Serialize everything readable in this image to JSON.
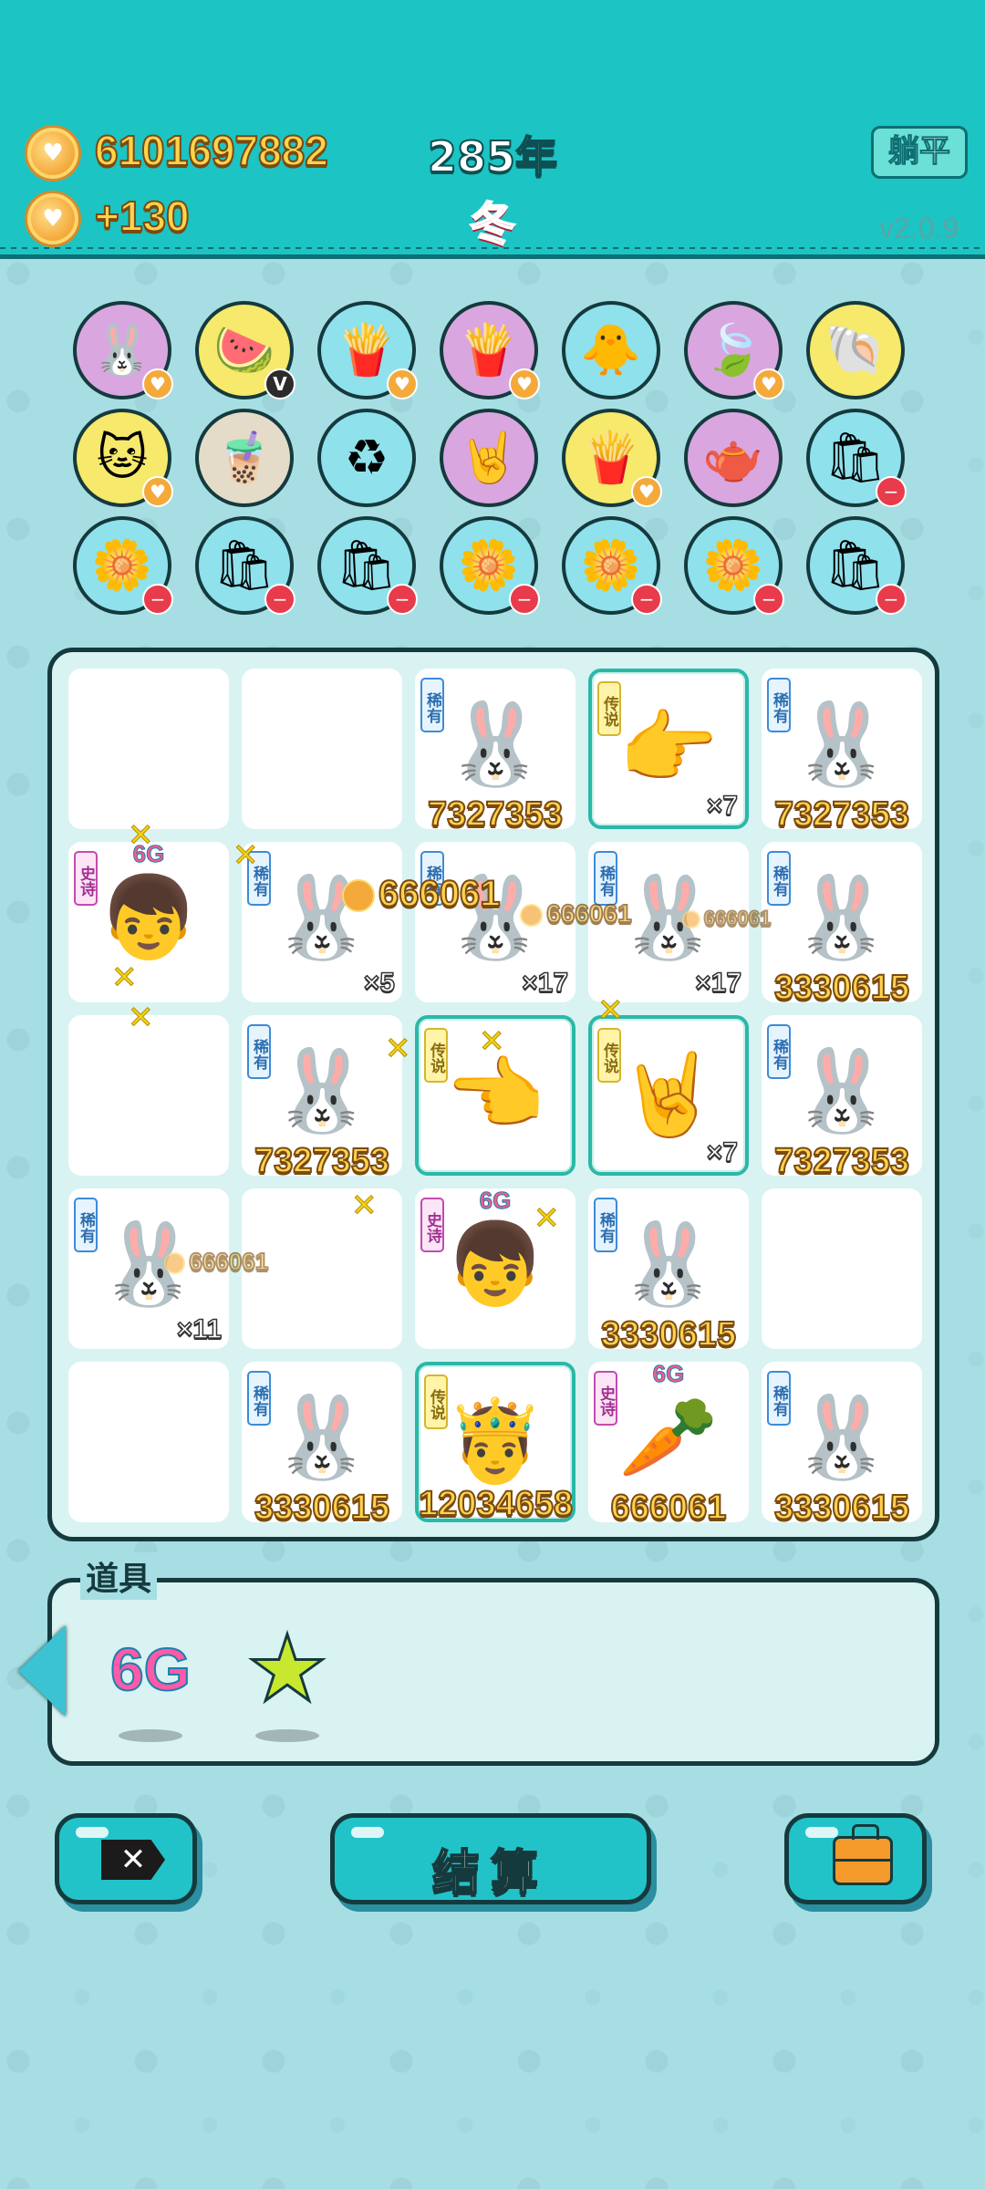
{
  "header": {
    "coins_total": "6101697882",
    "coins_income": "+130",
    "year": "285年",
    "season": "冬",
    "lie_flat_label": "躺平",
    "version": "v2.0.9"
  },
  "items": {
    "row1": [
      {
        "icon": "🐰",
        "name": "bunny",
        "bg": "#d9a6e0",
        "badge": "coin"
      },
      {
        "icon": "🍉",
        "name": "fruit-basket",
        "bg": "#f6e96b",
        "badge": "v"
      },
      {
        "icon": "🍟",
        "name": "fries",
        "bg": "#8fe1ec",
        "badge": "coin"
      },
      {
        "icon": "🍟",
        "name": "fries",
        "bg": "#d9a6e0",
        "badge": "coin"
      },
      {
        "icon": "🐥",
        "name": "pot-duck",
        "bg": "#8fe1ec",
        "badge": ""
      },
      {
        "icon": "🍃",
        "name": "leaf",
        "bg": "#d9a6e0",
        "badge": "coin"
      },
      {
        "icon": "🐚",
        "name": "shell",
        "bg": "#f6e96b",
        "badge": ""
      }
    ],
    "row2": [
      {
        "icon": "🐱",
        "name": "cat-glasses",
        "bg": "#f6e96b",
        "badge": "coin"
      },
      {
        "icon": "🧋",
        "name": "milk-tea",
        "bg": "#e4dcc8",
        "badge": ""
      },
      {
        "icon": "♻",
        "name": "trash-bag",
        "bg": "#8fe1ec",
        "badge": ""
      },
      {
        "icon": "🤘",
        "name": "rock-hand",
        "bg": "#d9a6e0",
        "badge": ""
      },
      {
        "icon": "🍟",
        "name": "fries",
        "bg": "#f6e96b",
        "badge": "coin"
      },
      {
        "icon": "🫖",
        "name": "gravy-boat",
        "bg": "#d9a6e0",
        "badge": ""
      },
      {
        "icon": "🛍",
        "name": "sack",
        "bg": "#8fe1ec",
        "badge": "minus"
      }
    ],
    "row3": [
      {
        "icon": "🌼",
        "name": "flower-pot",
        "bg": "#8fe1ec",
        "badge": "minus"
      },
      {
        "icon": "🛍",
        "name": "sack",
        "bg": "#8fe1ec",
        "badge": "minus"
      },
      {
        "icon": "🛍",
        "name": "sack",
        "bg": "#8fe1ec",
        "badge": "minus"
      },
      {
        "icon": "🌼",
        "name": "flower-pot",
        "bg": "#8fe1ec",
        "badge": "minus"
      },
      {
        "icon": "🌼",
        "name": "flower-pot",
        "bg": "#8fe1ec",
        "badge": "minus"
      },
      {
        "icon": "🌼",
        "name": "flower-pot",
        "bg": "#8fe1ec",
        "badge": "minus"
      },
      {
        "icon": "🛍",
        "name": "sack",
        "bg": "#8fe1ec",
        "badge": "minus"
      }
    ]
  },
  "board": [
    {
      "rarity": "",
      "rarity_label": "",
      "icon": "",
      "value": "",
      "mult": "",
      "tag6g": ""
    },
    {
      "rarity": "",
      "rarity_label": "",
      "icon": "",
      "value": "",
      "mult": "",
      "tag6g": ""
    },
    {
      "rarity": "rare",
      "rarity_label": "稀有",
      "icon": "🐰",
      "value": "7327353",
      "mult": "",
      "tag6g": ""
    },
    {
      "rarity": "legend",
      "rarity_label": "传说",
      "icon": "👉",
      "value": "",
      "mult": "×7",
      "tag6g": ""
    },
    {
      "rarity": "rare",
      "rarity_label": "稀有",
      "icon": "🐰",
      "value": "7327353",
      "mult": "",
      "tag6g": ""
    },
    {
      "rarity": "epic",
      "rarity_label": "史诗",
      "icon": "👦",
      "value": "",
      "mult": "",
      "tag6g": "6G"
    },
    {
      "rarity": "rare",
      "rarity_label": "稀有",
      "icon": "🐰",
      "value": "",
      "mult": "×5",
      "tag6g": ""
    },
    {
      "rarity": "rare",
      "rarity_label": "稀有",
      "icon": "🐰",
      "value": "",
      "mult": "×17",
      "tag6g": ""
    },
    {
      "rarity": "rare",
      "rarity_label": "稀有",
      "icon": "🐰",
      "value": "",
      "mult": "×17",
      "tag6g": ""
    },
    {
      "rarity": "rare",
      "rarity_label": "稀有",
      "icon": "🐰",
      "value": "3330615",
      "mult": "",
      "tag6g": ""
    },
    {
      "rarity": "",
      "rarity_label": "",
      "icon": "",
      "value": "",
      "mult": "",
      "tag6g": ""
    },
    {
      "rarity": "rare",
      "rarity_label": "稀有",
      "icon": "🐰",
      "value": "7327353",
      "mult": "",
      "tag6g": ""
    },
    {
      "rarity": "legend",
      "rarity_label": "传说",
      "icon": "👈",
      "value": "",
      "mult": "",
      "tag6g": ""
    },
    {
      "rarity": "legend",
      "rarity_label": "传说",
      "icon": "🤘",
      "value": "",
      "mult": "×7",
      "tag6g": ""
    },
    {
      "rarity": "rare",
      "rarity_label": "稀有",
      "icon": "🐰",
      "value": "7327353",
      "mult": "",
      "tag6g": ""
    },
    {
      "rarity": "rare",
      "rarity_label": "稀有",
      "icon": "🐰",
      "value": "",
      "mult": "×11",
      "tag6g": ""
    },
    {
      "rarity": "",
      "rarity_label": "",
      "icon": "",
      "value": "",
      "mult": "",
      "tag6g": ""
    },
    {
      "rarity": "epic",
      "rarity_label": "史诗",
      "icon": "👦",
      "value": "",
      "mult": "",
      "tag6g": "6G"
    },
    {
      "rarity": "rare",
      "rarity_label": "稀有",
      "icon": "🐰",
      "value": "3330615",
      "mult": "",
      "tag6g": ""
    },
    {
      "rarity": "",
      "rarity_label": "",
      "icon": "",
      "value": "",
      "mult": "",
      "tag6g": ""
    },
    {
      "rarity": "",
      "rarity_label": "",
      "icon": "",
      "value": "",
      "mult": "",
      "tag6g": ""
    },
    {
      "rarity": "rare",
      "rarity_label": "稀有",
      "icon": "🐰",
      "value": "3330615",
      "mult": "",
      "tag6g": ""
    },
    {
      "rarity": "legend",
      "rarity_label": "传说",
      "icon": "🤴",
      "value": "12034658",
      "mult": "",
      "tag6g": ""
    },
    {
      "rarity": "epic",
      "rarity_label": "史诗",
      "icon": "🥕",
      "value": "666061",
      "mult": "",
      "tag6g": "6G"
    },
    {
      "rarity": "rare",
      "rarity_label": "稀有",
      "icon": "🐰",
      "value": "3330615",
      "mult": "",
      "tag6g": ""
    }
  ],
  "floating_income": [
    "666061",
    "666061",
    "666061",
    "666061"
  ],
  "props": {
    "title": "道具",
    "items": [
      {
        "name": "6g-prop",
        "label": "6G"
      },
      {
        "name": "star-prop",
        "label": "★"
      }
    ]
  },
  "buttons": {
    "exit_icon": "✕",
    "settle_label": "结算"
  },
  "colors": {
    "header_bg": "#1cc4c4",
    "page_bg": "#a6dee3",
    "gold": "#ffd34d",
    "legend_border": "#2bb8a8"
  }
}
